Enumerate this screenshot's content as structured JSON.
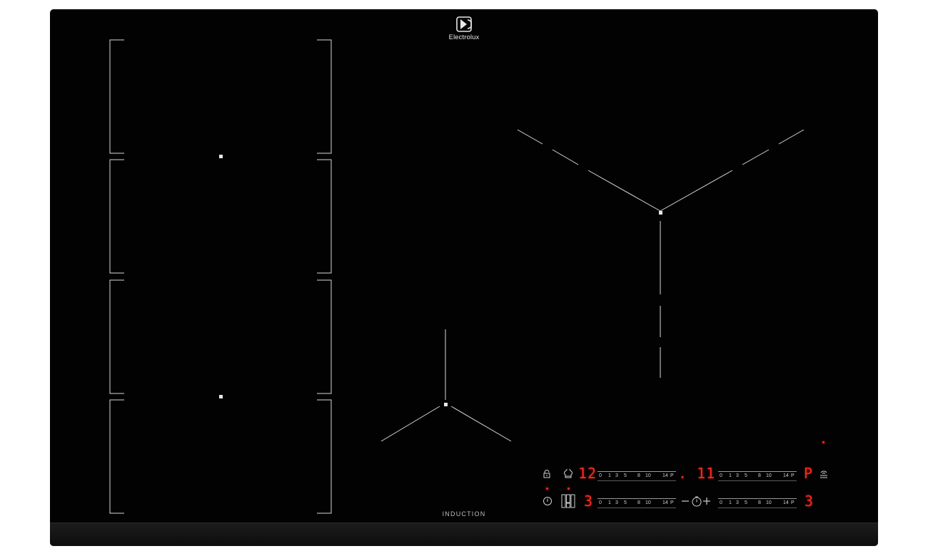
{
  "brand": {
    "name": "Electrolux",
    "logo_icon": "electrolux-logo-icon"
  },
  "surface_label": "INDUCTION",
  "colors": {
    "glass": "#020202",
    "display_red": "#ff2a1f",
    "marking": "#d8d8d8"
  },
  "controls": {
    "icons": {
      "lock": "lock-icon",
      "chef_hat": "chef-hat-icon",
      "power": "power-icon",
      "bridge": "bridge-zones-icon",
      "timer_minus": "minus-icon",
      "timer": "timer-icon",
      "timer_plus": "plus-icon",
      "hob2hood": "hob2hood-icon"
    },
    "displays": {
      "top_left": "12",
      "top_mid": ". 11",
      "top_right": "P",
      "bottom_left": "3",
      "bottom_right": "3"
    },
    "slider_marks": [
      "0",
      "1",
      "3",
      "5",
      "8",
      "10",
      "14",
      "P"
    ]
  }
}
